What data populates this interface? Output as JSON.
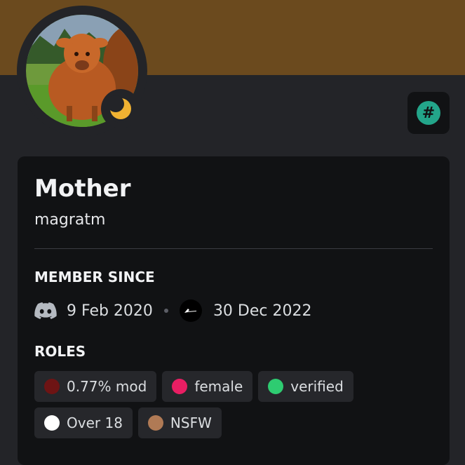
{
  "profile": {
    "display_name": "Mother",
    "username": "magratm",
    "status": "idle",
    "banner_color": "#6b4a1e"
  },
  "member_since": {
    "title": "MEMBER SINCE",
    "discord_date": "9 Feb 2020",
    "server_date": "30 Dec 2022",
    "discord_icon": "discord-icon",
    "server_icon": "server-icon"
  },
  "roles": {
    "title": "ROLES",
    "items": [
      {
        "label": "0.77% mod",
        "color": "#6e1414"
      },
      {
        "label": "female",
        "color": "#e91e63"
      },
      {
        "label": "verified",
        "color": "#2ecc71"
      },
      {
        "label": "Over 18",
        "color": "#ffffff"
      },
      {
        "label": "NSFW",
        "color": "#b07a55"
      }
    ]
  },
  "badges": {
    "hash_icon": "hash-icon",
    "hash_symbol": "#",
    "hash_color": "#23a58a"
  }
}
